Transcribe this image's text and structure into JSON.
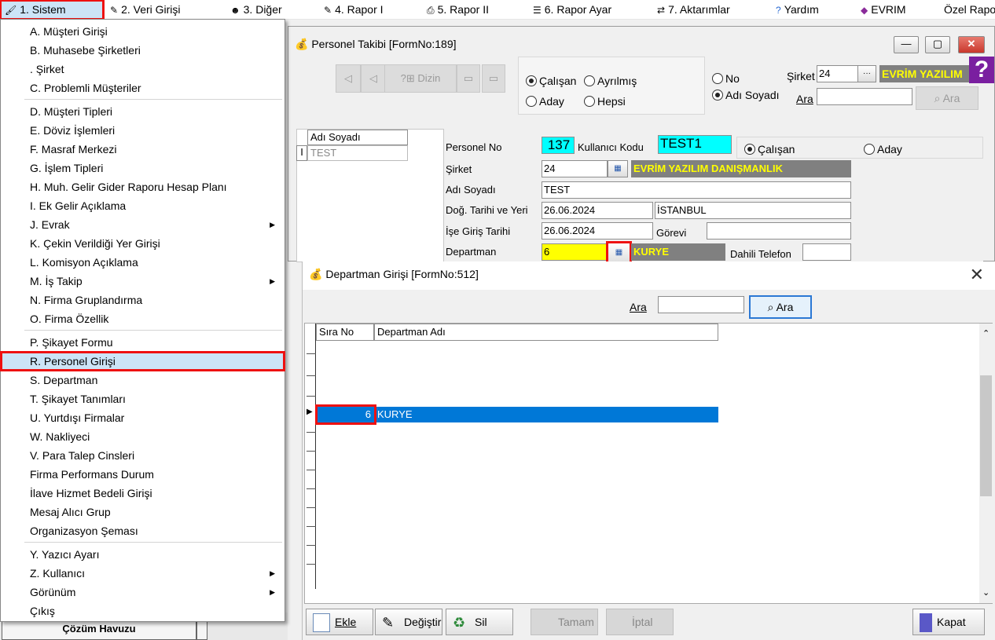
{
  "menubar": {
    "items": [
      {
        "label": "1.  Sistem",
        "icon": "paint-icon"
      },
      {
        "label": "2.  Veri Girişi",
        "icon": "edit-icon"
      },
      {
        "label": "3.  Diğer",
        "icon": "people-icon"
      },
      {
        "label": "4.   Rapor I",
        "icon": "report-icon"
      },
      {
        "label": "5.   Rapor II",
        "icon": "printer-icon"
      },
      {
        "label": "6.   Rapor Ayar",
        "icon": "list-icon"
      },
      {
        "label": "7.   Aktarımlar",
        "icon": "transfer-icon"
      },
      {
        "label": "Yardım",
        "icon": "help-icon"
      },
      {
        "label": "EVRIM",
        "icon": "evrim-icon"
      },
      {
        "label": "Özel Rapor",
        "icon": ""
      }
    ]
  },
  "menu": {
    "items": [
      {
        "label": "A.   Müşteri Girişi"
      },
      {
        "label": "B.   Muhasebe Şirketleri"
      },
      {
        "label": ".    Şirket"
      },
      {
        "label": "C.   Problemli Müşteriler"
      },
      {
        "label": "D.   Müşteri Tipleri"
      },
      {
        "label": "E.   Döviz İşlemleri"
      },
      {
        "label": "F.   Masraf Merkezi"
      },
      {
        "label": "G.   İşlem Tipleri"
      },
      {
        "label": "H.   Muh. Gelir Gider Raporu Hesap Planı"
      },
      {
        "label": "I.   Ek Gelir Açıklama"
      },
      {
        "label": "J.   Evrak"
      },
      {
        "label": "K.   Çekin Verildiği Yer Girişi"
      },
      {
        "label": "L.   Komisyon Açıklama"
      },
      {
        "label": "M.   İş Takip"
      },
      {
        "label": "N.   Firma Gruplandırma"
      },
      {
        "label": "O.  Firma Özellik"
      },
      {
        "label": "P.   Şikayet Formu"
      },
      {
        "label": "R.   Personel Girişi"
      },
      {
        "label": "S.   Departman"
      },
      {
        "label": "T.   Şikayet Tanımları"
      },
      {
        "label": "U.   Yurtdışı Firmalar"
      },
      {
        "label": "W.   Nakliyeci"
      },
      {
        "label": "V.  Para Talep Cinsleri"
      },
      {
        "label": "Firma Performans Durum"
      },
      {
        "label": "İlave Hizmet Bedeli Girişi"
      },
      {
        "label": "Mesaj Alıcı Grup"
      },
      {
        "label": "Organizasyon Şeması"
      },
      {
        "label": "Y.   Yazıcı Ayarı"
      },
      {
        "label": "Z.   Kullanıcı"
      },
      {
        "label": "Görünüm"
      },
      {
        "label": "Çıkış"
      }
    ]
  },
  "background": {
    "cozum_label": "Çözüm Havuzu"
  },
  "personel": {
    "title": "Personel Takibi [FormNo:189]",
    "toolbar": {
      "dizin_label": "Dizin"
    },
    "status_radios": {
      "calisan": "Çalışan",
      "ayrilmis": "Ayrılmış",
      "aday": "Aday",
      "hepsi": "Hepsi"
    },
    "search_radios": {
      "no": "No",
      "adi_soyadi": "Adı Soyadı"
    },
    "sirket_label": "Şirket",
    "sirket_value": "24",
    "sirket_name": "EVRİM YAZILIM",
    "ara_label": "Ara",
    "ara_button": "Ara",
    "grid": {
      "header": "Adı Soyadı",
      "row_marker": "I",
      "row": "TEST"
    },
    "form": {
      "personel_no_label": "Personel No",
      "personel_no": "137",
      "kullanici_kodu_label": "Kullanıcı Kodu",
      "kullanici_kodu": "TEST1",
      "calisan": "Çalışan",
      "aday": "Aday",
      "sirket_label": "Şirket",
      "sirket_value": "24",
      "sirket_name": "EVRİM YAZILIM DANIŞMANLIK",
      "adi_soyadi_label": "Adı Soyadı",
      "adi_soyadi": "TEST",
      "dogum_label": "Doğ. Tarihi ve Yeri",
      "dogum_tarihi": "26.06.2024",
      "dogum_yeri": "İSTANBUL",
      "ise_giris_label": "İşe Giriş Tarihi",
      "ise_giris": "26.06.2024",
      "gorevi_label": "Görevi",
      "departman_label": "Departman",
      "departman_value": "6",
      "departman_name": "KURYE",
      "dahili_label": "Dahili Telefon"
    }
  },
  "departman": {
    "title": "Departman Girişi [FormNo:512]",
    "ara_label": "Ara",
    "ara_button": "Ara",
    "columns": [
      "Sıra No",
      "Departman Adı"
    ],
    "rows": [
      {
        "sira": "6",
        "adi": "KURYE"
      }
    ],
    "buttons": {
      "ekle": "Ekle",
      "degistir": "Değiştir",
      "sil": "Sil",
      "tamam": "Tamam",
      "iptal": "İptal",
      "kapat": "Kapat"
    }
  },
  "colors": {
    "accent": "#0078d7",
    "highlight": "#e11111",
    "cyan": "#00ffff",
    "yellow": "#ffff00"
  }
}
